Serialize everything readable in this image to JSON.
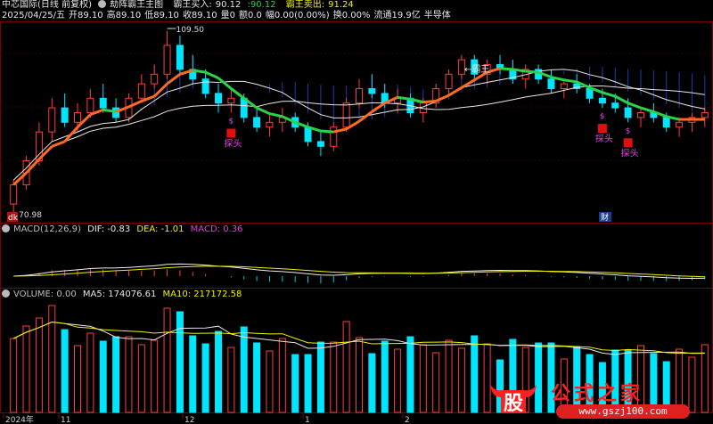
{
  "title_bar": {
    "stock": "中芯国际(日线 前复权)",
    "indicator": "劫阵霸王主图",
    "buy_label": "霸王买入:",
    "buy_value": "90.12",
    "buy_value2": "90.12",
    "sell_label": "霸王卖出:",
    "sell_value": "91.24"
  },
  "info_bar": {
    "date": "2025/04/25/五",
    "open": "开89.10",
    "high": "高89.10",
    "low": "低89.10",
    "close": "收89.10",
    "volume": "量0",
    "amount": "额0.0",
    "change": "幅0.00(0.00%)",
    "turnover": "换0.00%",
    "float_cap": "流通19.9亿",
    "sector": "半导体"
  },
  "main_chart": {
    "high_mark": "109.50",
    "low_mark": "70.98",
    "label_bawang": "←霸王",
    "label_tantou1": "探头",
    "label_tantou2": "探头",
    "label_tantou3": "探头",
    "dollar": "$",
    "badge_dk": "dk",
    "badge_cai": "财"
  },
  "macd_bar": {
    "label": "MACD(12,26,9)",
    "dif": "DIF: -0.83",
    "dea": "DEA: -1.01",
    "macd": "MACD: 0.36"
  },
  "volume_bar": {
    "label": "VOLUME: 0.00",
    "ma5": "MA5: 174076.61",
    "ma10": "MA10: 217172.58"
  },
  "x_axis": {
    "labels": [
      "2024年",
      "11",
      "12",
      "1",
      "2"
    ]
  },
  "logo": {
    "text": "公式之家",
    "url": "www.gszj100.com",
    "mark": "股"
  },
  "colors": {
    "up": "#ff3c3c",
    "down": "#00e5ff",
    "ma_white": "#e8e8e8",
    "green_band": "#29d34a",
    "orange_band": "#ff6a20",
    "panel_border": "#8a0000"
  },
  "chart_data": {
    "type": "candlestick",
    "x": [
      "2024年",
      "11",
      "12",
      "1",
      "2"
    ],
    "ylim": [
      70.98,
      109.5
    ],
    "series": [
      {
        "name": "霸王买入",
        "values": [
          90.12
        ]
      },
      {
        "name": "霸王卖出",
        "values": [
          91.24
        ]
      }
    ],
    "macd": {
      "dif": -0.83,
      "dea": -1.01,
      "macd": 0.36
    },
    "volume": {
      "value": 0.0,
      "ma5": 174076.61,
      "ma10": 217172.58
    },
    "candles": [
      [
        73,
        78,
        71,
        77
      ],
      [
        77,
        83,
        76,
        82
      ],
      [
        82,
        90,
        81,
        88
      ],
      [
        88,
        95,
        86,
        93
      ],
      [
        93,
        96,
        89,
        90
      ],
      [
        90,
        94,
        88,
        92
      ],
      [
        92,
        97,
        91,
        95
      ],
      [
        95,
        98,
        92,
        93
      ],
      [
        93,
        95,
        90,
        91
      ],
      [
        91,
        96,
        90,
        95
      ],
      [
        95,
        100,
        94,
        98
      ],
      [
        98,
        102,
        97,
        100
      ],
      [
        100,
        109,
        99,
        106
      ],
      [
        106,
        108,
        100,
        101
      ],
      [
        101,
        104,
        98,
        99
      ],
      [
        99,
        101,
        95,
        96
      ],
      [
        96,
        98,
        92,
        94
      ],
      [
        94,
        97,
        92,
        95
      ],
      [
        95,
        96,
        90,
        91
      ],
      [
        91,
        93,
        88,
        89
      ],
      [
        89,
        92,
        87,
        90
      ],
      [
        90,
        93,
        88,
        91
      ],
      [
        91,
        92,
        88,
        89
      ],
      [
        89,
        90,
        85,
        86
      ],
      [
        86,
        88,
        83,
        85
      ],
      [
        85,
        90,
        84,
        89
      ],
      [
        89,
        95,
        88,
        94
      ],
      [
        94,
        99,
        93,
        97
      ],
      [
        97,
        100,
        95,
        96
      ],
      [
        96,
        98,
        93,
        94
      ],
      [
        94,
        97,
        92,
        95
      ],
      [
        95,
        96,
        91,
        92
      ],
      [
        92,
        95,
        90,
        94
      ],
      [
        94,
        98,
        93,
        97
      ],
      [
        97,
        101,
        96,
        100
      ],
      [
        100,
        104,
        99,
        103
      ],
      [
        103,
        104,
        99,
        100
      ],
      [
        100,
        103,
        98,
        102
      ],
      [
        102,
        104,
        100,
        101
      ],
      [
        101,
        103,
        98,
        99
      ],
      [
        99,
        102,
        97,
        101
      ],
      [
        101,
        102,
        98,
        99
      ],
      [
        99,
        101,
        96,
        97
      ],
      [
        97,
        99,
        95,
        98
      ],
      [
        98,
        100,
        96,
        97
      ],
      [
        97,
        98,
        94,
        95
      ],
      [
        95,
        97,
        93,
        94
      ],
      [
        94,
        96,
        92,
        93
      ],
      [
        93,
        95,
        90,
        91
      ],
      [
        91,
        93,
        89,
        92
      ],
      [
        92,
        94,
        90,
        91
      ],
      [
        91,
        92,
        88,
        89
      ],
      [
        89,
        91,
        87,
        90
      ],
      [
        90,
        92,
        88,
        91
      ],
      [
        91,
        93,
        89,
        92
      ]
    ]
  }
}
